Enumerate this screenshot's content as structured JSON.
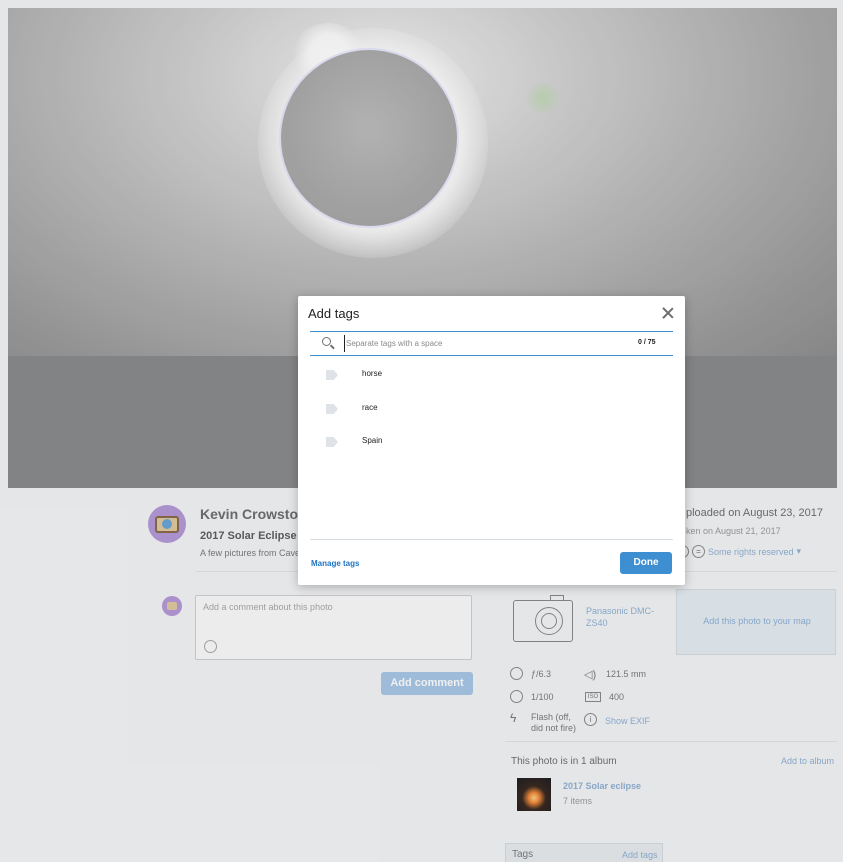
{
  "modal": {
    "title": "Add tags",
    "input_placeholder": "Separate tags with a space",
    "input_value": "",
    "counter": "0 / 75",
    "suggested_tags": [
      "horse",
      "race",
      "Spain"
    ],
    "manage_label": "Manage tags",
    "done_label": "Done"
  },
  "owner": {
    "name": "Kevin Crowston",
    "photo_title": "2017 Solar Eclipse",
    "description": "A few pictures from Cave"
  },
  "meta": {
    "uploaded": "ploaded on August 23, 2017",
    "taken": "ken on August 21, 2017",
    "rights": "Some rights reserved"
  },
  "comment": {
    "placeholder": "Add a comment about this photo",
    "button": "Add comment"
  },
  "camera": {
    "model": "Panasonic DMC-ZS40",
    "map_cta": "Add this photo to your map"
  },
  "exif": {
    "aperture": "ƒ/6.3",
    "focal_length": "121.5 mm",
    "shutter": "1/100",
    "iso": "400",
    "flash": "Flash (off, did not fire)",
    "show_exif": "Show EXIF"
  },
  "album": {
    "heading": "This photo is in 1 album",
    "add_label": "Add to album",
    "title": "2017 Solar eclipse",
    "count": "7 items"
  },
  "tags_panel": {
    "heading": "Tags",
    "add_label": "Add tags"
  }
}
